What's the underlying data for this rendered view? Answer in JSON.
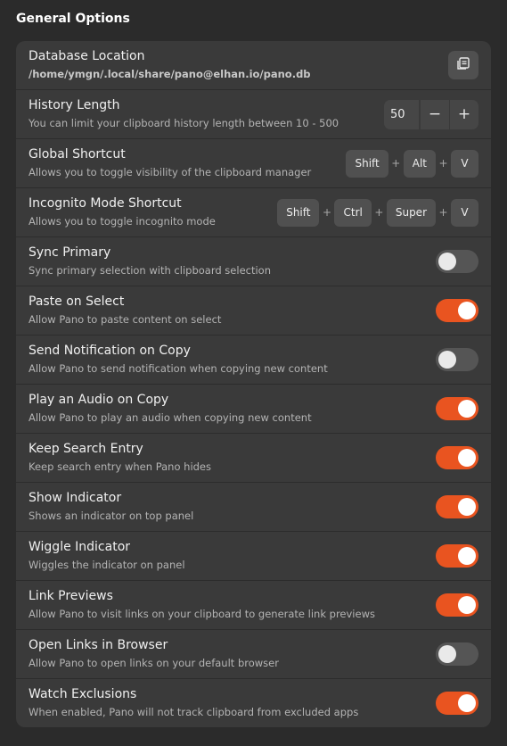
{
  "section": {
    "title": "General Options"
  },
  "database": {
    "title": "Database Location",
    "path": "/home/ymgn/.local/share/pano@elhan.io/pano.db",
    "button_icon": "file-chooser-icon"
  },
  "history": {
    "title": "History Length",
    "subtitle": "You can limit your clipboard history length between 10 - 500",
    "value": "50",
    "minus": "−",
    "plus": "+"
  },
  "global_shortcut": {
    "title": "Global Shortcut",
    "subtitle": "Allows you to toggle visibility of the clipboard manager",
    "keys": [
      "Shift",
      "Alt",
      "V"
    ],
    "separator": "+"
  },
  "incognito_shortcut": {
    "title": "Incognito Mode Shortcut",
    "subtitle": "Allows you to toggle incognito mode",
    "keys": [
      "Shift",
      "Ctrl",
      "Super",
      "V"
    ],
    "separator": "+"
  },
  "toggles": [
    {
      "title": "Sync Primary",
      "subtitle": "Sync primary selection with clipboard selection",
      "on": false
    },
    {
      "title": "Paste on Select",
      "subtitle": "Allow Pano to paste content on select",
      "on": true
    },
    {
      "title": "Send Notification on Copy",
      "subtitle": "Allow Pano to send notification when copying new content",
      "on": false
    },
    {
      "title": "Play an Audio on Copy",
      "subtitle": "Allow Pano to play an audio when copying new content",
      "on": true
    },
    {
      "title": "Keep Search Entry",
      "subtitle": "Keep search entry when Pano hides",
      "on": true
    },
    {
      "title": "Show Indicator",
      "subtitle": "Shows an indicator on top panel",
      "on": true
    },
    {
      "title": "Wiggle Indicator",
      "subtitle": "Wiggles the indicator on panel",
      "on": true
    },
    {
      "title": "Link Previews",
      "subtitle": "Allow Pano to visit links on your clipboard to generate link previews",
      "on": true
    },
    {
      "title": "Open Links in Browser",
      "subtitle": "Allow Pano to open links on your default browser",
      "on": false
    },
    {
      "title": "Watch Exclusions",
      "subtitle": "When enabled, Pano will not track clipboard from excluded apps",
      "on": true
    }
  ],
  "colors": {
    "accent": "#e95420",
    "card": "#3a3a3a",
    "background": "#2b2b2b"
  }
}
